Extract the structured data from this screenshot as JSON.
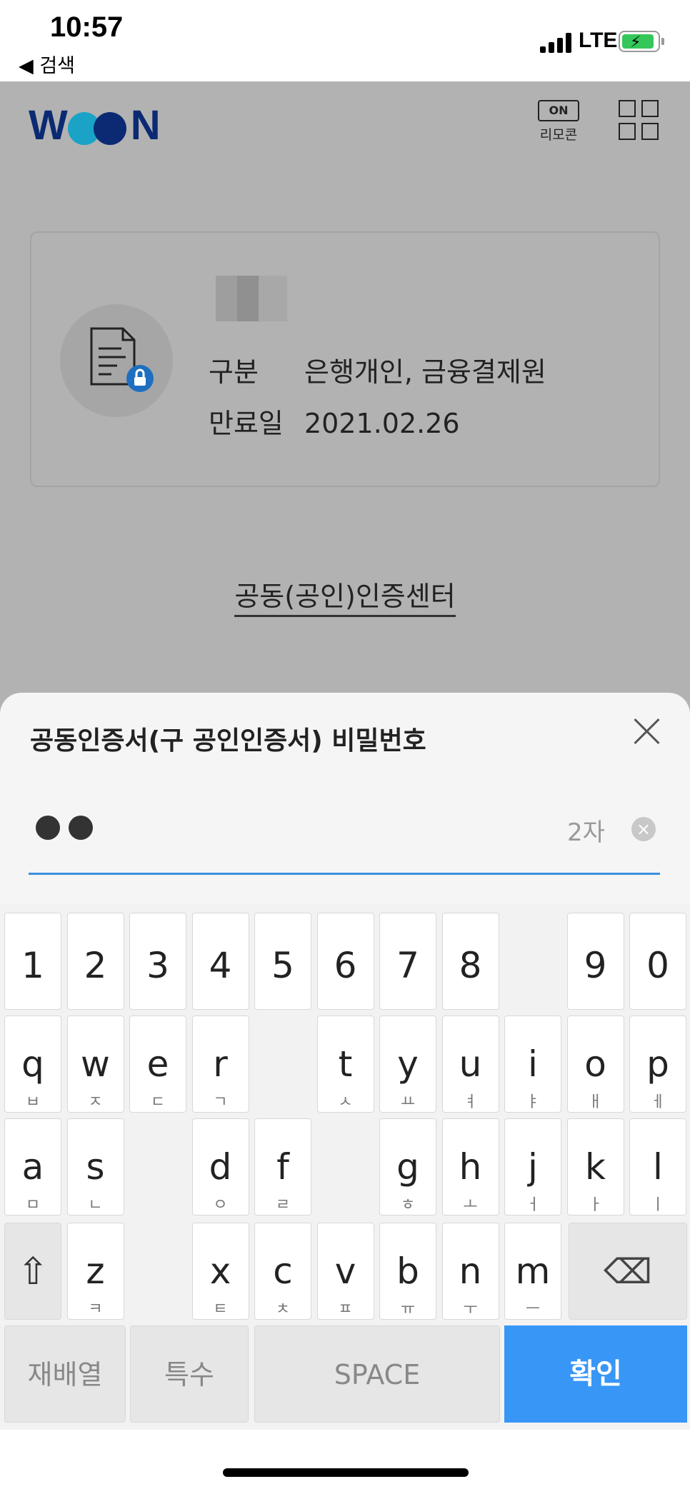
{
  "status": {
    "time": "10:57",
    "back_label": "◀ 검색",
    "network": "LTE",
    "colors": {
      "battery": "#35c759"
    }
  },
  "header": {
    "logo": "WOON",
    "remote_switch": "ON",
    "remote_label": "리모콘"
  },
  "certificate": {
    "category_label": "구분",
    "category_value": "은행개인, 금융결제원",
    "expiry_label": "만료일",
    "expiry_value": "2021.02.26"
  },
  "link": {
    "cert_center": "공동(공인)인증센터"
  },
  "sheet": {
    "title": "공동인증서(구 공인인증서) 비밀번호",
    "count": "2자",
    "clear_icon": "×",
    "accent": "#3b8fe0"
  },
  "keyboard": {
    "numbers": [
      "1",
      "2",
      "3",
      "4",
      "5",
      "6",
      "7",
      "8",
      "9",
      "0"
    ],
    "row1": [
      [
        "q",
        "ㅂ"
      ],
      [
        "w",
        "ㅈ"
      ],
      [
        "e",
        "ㄷ"
      ],
      [
        "r",
        "ㄱ"
      ],
      [
        "t",
        "ㅅ"
      ],
      [
        "y",
        "ㅛ"
      ],
      [
        "u",
        "ㅕ"
      ],
      [
        "i",
        "ㅑ"
      ],
      [
        "o",
        "ㅐ"
      ],
      [
        "p",
        "ㅔ"
      ]
    ],
    "row2": [
      [
        "a",
        "ㅁ"
      ],
      [
        "s",
        "ㄴ"
      ],
      [
        "d",
        "ㅇ"
      ],
      [
        "f",
        "ㄹ"
      ],
      [
        "g",
        "ㅎ"
      ],
      [
        "h",
        "ㅗ"
      ],
      [
        "j",
        "ㅓ"
      ],
      [
        "k",
        "ㅏ"
      ],
      [
        "l",
        "ㅣ"
      ]
    ],
    "row3": [
      [
        "z",
        "ㅋ"
      ],
      [
        "x",
        "ㅌ"
      ],
      [
        "c",
        "ㅊ"
      ],
      [
        "v",
        "ㅍ"
      ],
      [
        "b",
        "ㅠ"
      ],
      [
        "n",
        "ㅜ"
      ],
      [
        "m",
        "ㅡ"
      ]
    ],
    "shift": "⇧",
    "backspace": "⌫",
    "rearrange": "재배열",
    "special": "특수",
    "space": "SPACE",
    "confirm": "확인",
    "confirm_color": "#3896f7"
  }
}
